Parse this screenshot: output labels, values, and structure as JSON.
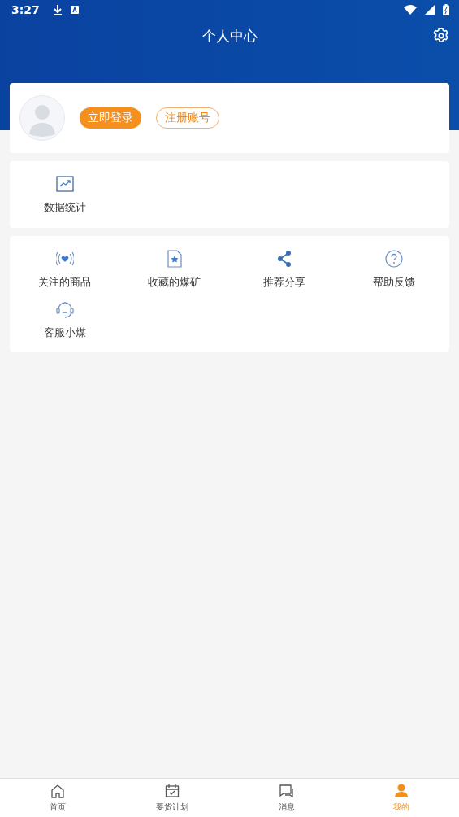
{
  "status_bar": {
    "time": "3:27"
  },
  "header": {
    "title": "个人中心"
  },
  "profile": {
    "login_button": "立即登录",
    "register_button": "注册账号"
  },
  "stats": [
    {
      "label": "数据统计"
    }
  ],
  "services": [
    {
      "label": "关注的商品"
    },
    {
      "label": "收藏的煤矿"
    },
    {
      "label": "推荐分享"
    },
    {
      "label": "帮助反馈"
    },
    {
      "label": "客服小煤"
    }
  ],
  "tabs": [
    {
      "label": "首页",
      "selected": false
    },
    {
      "label": "要货计划",
      "selected": false
    },
    {
      "label": "消息",
      "selected": false
    },
    {
      "label": "我的",
      "selected": true
    }
  ]
}
